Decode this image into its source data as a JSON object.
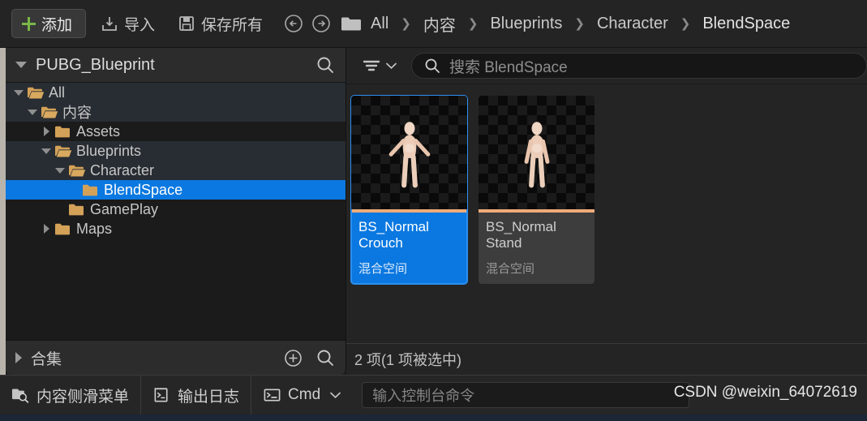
{
  "toolbar": {
    "add_label": "添加",
    "import_label": "导入",
    "save_all_label": "保存所有",
    "back_icon": "arrow-left-circle-icon",
    "forward_icon": "arrow-right-circle-icon",
    "folder_icon": "folder-icon"
  },
  "breadcrumb": {
    "items": [
      {
        "label": "All"
      },
      {
        "label": "内容"
      },
      {
        "label": "Blueprints"
      },
      {
        "label": "Character"
      },
      {
        "label": "BlendSpace"
      }
    ],
    "separator": "❯"
  },
  "sidebar": {
    "title": "PUBG_Blueprint",
    "search_icon": "search-icon",
    "tree": [
      {
        "label": "All",
        "depth": 0,
        "state": "expanded",
        "folder": "open",
        "row": "alt"
      },
      {
        "label": "内容",
        "depth": 1,
        "state": "expanded",
        "folder": "open",
        "row": "alt"
      },
      {
        "label": "Assets",
        "depth": 2,
        "state": "collapsed",
        "folder": "closed",
        "row": "dark"
      },
      {
        "label": "Blueprints",
        "depth": 2,
        "state": "expanded",
        "folder": "open",
        "row": "alt"
      },
      {
        "label": "Character",
        "depth": 3,
        "state": "expanded",
        "folder": "open",
        "row": "alt"
      },
      {
        "label": "BlendSpace",
        "depth": 4,
        "state": "leaf",
        "folder": "closed",
        "row": "selected"
      },
      {
        "label": "GamePlay",
        "depth": 3,
        "state": "leaf",
        "folder": "closed",
        "row": "dark"
      },
      {
        "label": "Maps",
        "depth": 2,
        "state": "collapsed",
        "folder": "closed",
        "row": "dark"
      }
    ],
    "collections": {
      "label": "合集",
      "add_icon": "plus-circle-icon",
      "search_icon": "search-icon"
    }
  },
  "content": {
    "filter_icon": "filter-icon",
    "filter_chevron_icon": "chevron-down-icon",
    "search_icon": "search-icon",
    "search_placeholder": "搜索 BlendSpace",
    "search_value": "",
    "assets": [
      {
        "name": "BS_Normal\nCrouch",
        "name_line1": "BS_Normal",
        "name_line2": "Crouch",
        "type": "混合空间",
        "selected": true
      },
      {
        "name": "BS_Normal\nStand",
        "name_line1": "BS_Normal",
        "name_line2": "Stand",
        "type": "混合空间",
        "selected": false
      }
    ],
    "status": "2 项(1 项被选中)"
  },
  "bottombar": {
    "content_drawer_label": "内容侧滑菜单",
    "content_drawer_icon": "folder-search-icon",
    "output_log_label": "输出日志",
    "output_log_icon": "log-icon",
    "cmd_label": "Cmd",
    "cmd_icon": "terminal-icon",
    "cmd_chevron_icon": "chevron-down-icon",
    "console_placeholder": "输入控制台命令",
    "console_value": ""
  },
  "watermark": {
    "text": "CSDN @weixin_64072619"
  },
  "colors": {
    "accent_blue": "#0a78e0",
    "tile_accent": "#efab78",
    "add_green": "#7ab648",
    "panel_bg": "#1b1b1b",
    "content_bg": "#242424"
  }
}
